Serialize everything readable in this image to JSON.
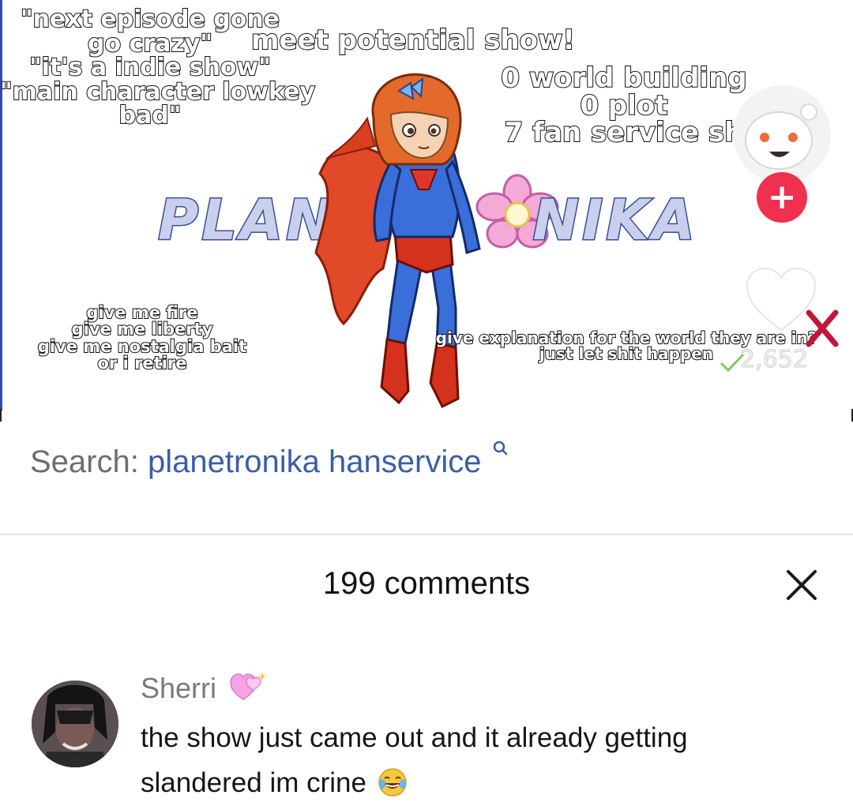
{
  "video": {
    "overlay_top_left": [
      "\"next episode gone",
      "go crazy\"",
      "\"it's a indie show\"",
      "\"main character lowkey",
      "bad\""
    ],
    "overlay_title": "meet potential show!",
    "overlay_top_right": [
      "0 world building",
      "0 plot",
      "7 fan service sh"
    ],
    "logo_left": "PLAN",
    "logo_right": "NIKA",
    "overlay_bottom_left": [
      "give me fire",
      "give me liberty",
      "give me nostalgia bait",
      "or i retire"
    ],
    "overlay_bottom_right": [
      "give explanation for the world they are in?",
      "just let shit happen"
    ],
    "like_count": "2,652",
    "follow_label": "+",
    "accent_color": "#f0304f"
  },
  "search": {
    "label": "Search:",
    "query": "planetronika hanservice",
    "icon": "search-icon"
  },
  "comments": {
    "title": "199 comments",
    "close_icon": "close-icon",
    "items": [
      {
        "author": "Sherri",
        "author_emoji": "sparkling-heart-icon",
        "text": "the show just came out and it already getting slandered im crine",
        "text_emoji": "tears-of-joy-icon"
      }
    ]
  }
}
